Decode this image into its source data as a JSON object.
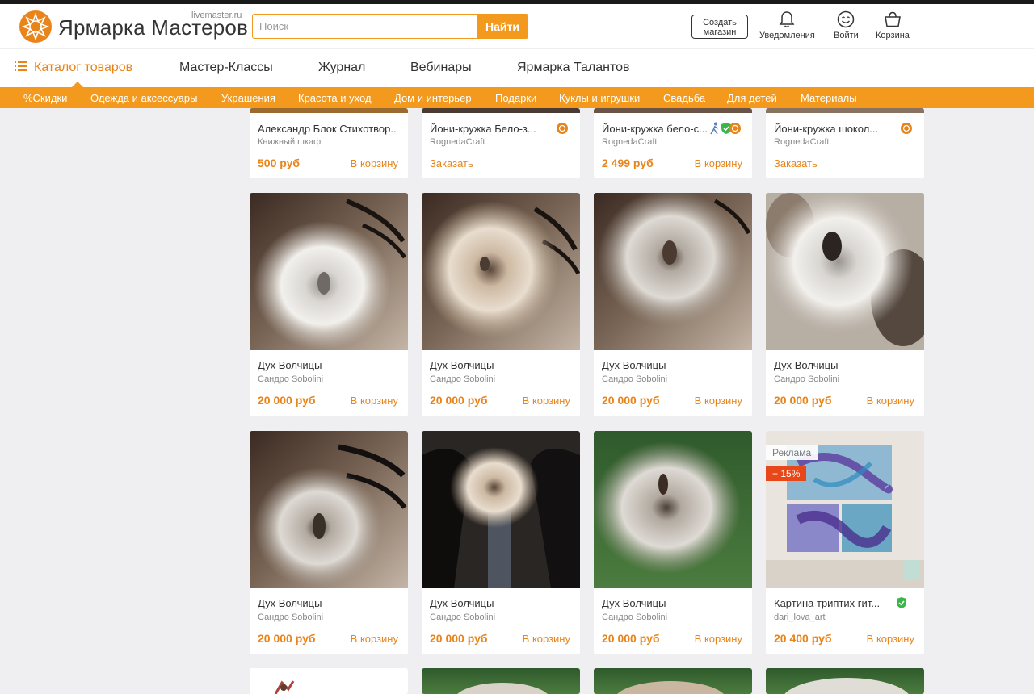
{
  "header": {
    "logo_name": "Ярмарка Мастеров",
    "logo_domain": "livemaster.ru",
    "search_placeholder": "Поиск",
    "search_button": "Найти",
    "create_shop_line1": "Создать",
    "create_shop_line2": "магазин",
    "notifications": "Уведомления",
    "login": "Войти",
    "cart": "Корзина"
  },
  "nav": {
    "catalog": "Каталог товаров",
    "items": [
      "Мастер-Классы",
      "Журнал",
      "Вебинары",
      "Ярмарка Талантов"
    ]
  },
  "categories": [
    "%Скидки",
    "Одежда и аксессуары",
    "Украшения",
    "Красота и уход",
    "Дом и интерьер",
    "Подарки",
    "Куклы и игрушки",
    "Свадьба",
    "Для детей",
    "Материалы"
  ],
  "colors": {
    "accent": "#f39a1e",
    "price": "#e8841a",
    "discount": "#e8471a",
    "verified": "#3bb54a"
  },
  "row1": [
    {
      "title": "Александр Блок Стихотвор...",
      "seller": "Книжный шкаф",
      "price": "500 руб",
      "action": "В корзину"
    },
    {
      "title": "Йони-кружка Бело-з...",
      "seller": "RognedaCraft",
      "action": "Заказать"
    },
    {
      "title": "Йони-кружка бело-с...",
      "seller": "RognedaCraft",
      "price": "2 499 руб",
      "action": "В корзину"
    },
    {
      "title": "Йони-кружка шокол...",
      "seller": "RognedaCraft",
      "action": "Заказать"
    }
  ],
  "row2": [
    {
      "title": "Дух Волчицы",
      "seller": "Сандро Sobolini",
      "price": "20 000 руб",
      "action": "В корзину"
    },
    {
      "title": "Дух Волчицы",
      "seller": "Сандро Sobolini",
      "price": "20 000 руб",
      "action": "В корзину"
    },
    {
      "title": "Дух Волчицы",
      "seller": "Сандро Sobolini",
      "price": "20 000 руб",
      "action": "В корзину"
    },
    {
      "title": "Дух Волчицы",
      "seller": "Сандро Sobolini",
      "price": "20 000 руб",
      "action": "В корзину"
    }
  ],
  "row3": [
    {
      "title": "Дух Волчицы",
      "seller": "Сандро Sobolini",
      "price": "20 000 руб",
      "action": "В корзину"
    },
    {
      "title": "Дух Волчицы",
      "seller": "Сандро Sobolini",
      "price": "20 000 руб",
      "action": "В корзину"
    },
    {
      "title": "Дух Волчицы",
      "seller": "Сандро Sobolini",
      "price": "20 000 руб",
      "action": "В корзину"
    },
    {
      "title": "Картина триптих гит...",
      "seller": "dari_lova_art",
      "price": "20 400 руб",
      "action": "В корзину",
      "ad_label": "Реклама",
      "discount": "− 15%"
    }
  ]
}
